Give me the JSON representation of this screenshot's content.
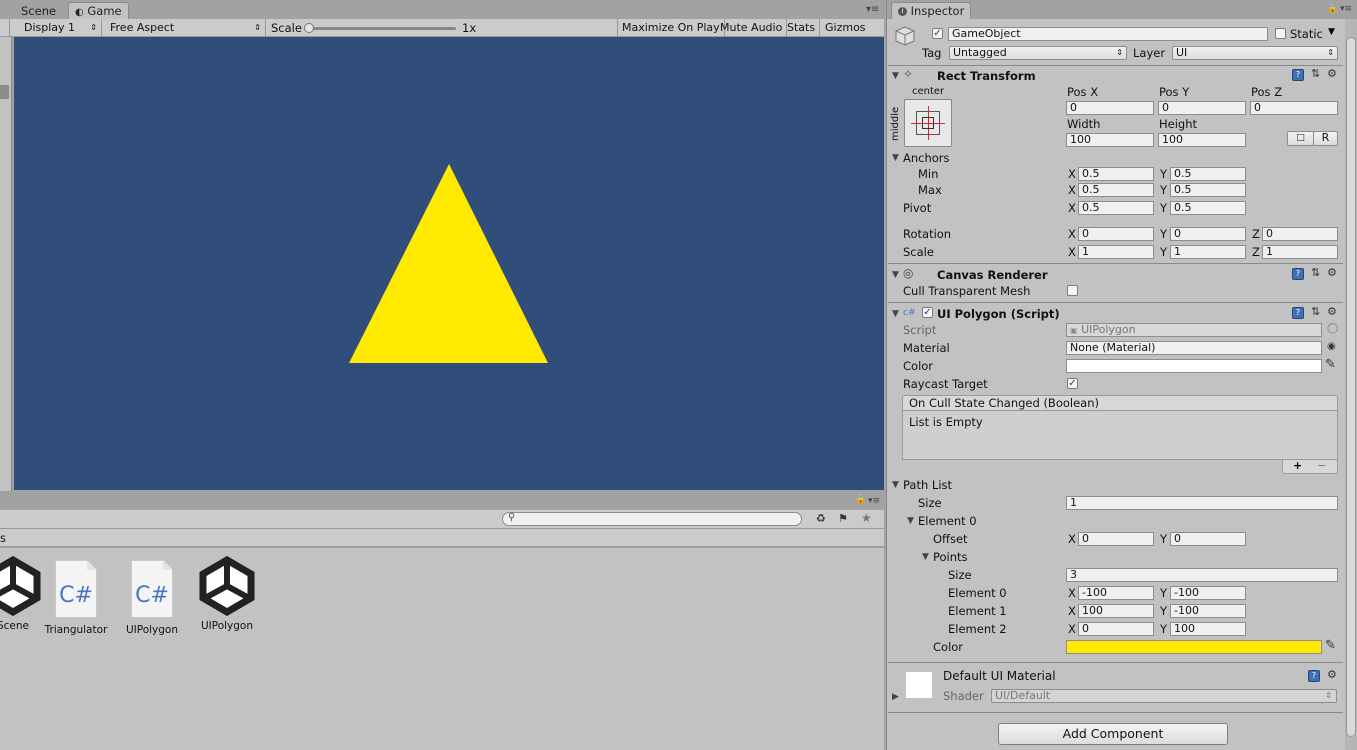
{
  "colors": {
    "game_bg": "#314d79",
    "triangle": "#ffea00",
    "yellow_field": "#ffea00",
    "editor_bg": "#c2c2c2",
    "inspector_bg": "#c2c2c2"
  },
  "tabs": {
    "scene": "Scene",
    "game": "Game",
    "inspector": "Inspector"
  },
  "game_toolbar": {
    "display": "Display 1",
    "aspect": "Free Aspect",
    "scale_label": "Scale",
    "scale_value": "1x",
    "maximize": "Maximize On Play",
    "mute": "Mute Audio",
    "stats": "Stats",
    "gizmos": "Gizmos"
  },
  "project": {
    "assets": [
      {
        "name": "Scene",
        "icon": "unity-scene-icon"
      },
      {
        "name": "Triangulator",
        "icon": "csharp-script-icon"
      },
      {
        "name": "UIPolygon",
        "icon": "csharp-script-icon"
      },
      {
        "name": "UIPolygon",
        "icon": "unity-scene-icon"
      }
    ],
    "cs_glyph": "C#",
    "partial_label": "s"
  },
  "inspector": {
    "object_name": "GameObject",
    "static_label": "Static",
    "tag_label": "Tag",
    "tag_value": "Untagged",
    "layer_label": "Layer",
    "layer_value": "UI",
    "rect_transform": {
      "title": "Rect Transform",
      "anchor_h": "center",
      "anchor_v": "middle",
      "pos_x_label": "Pos X",
      "pos_y_label": "Pos Y",
      "pos_z_label": "Pos Z",
      "pos_x": "0",
      "pos_y": "0",
      "pos_z": "0",
      "width_label": "Width",
      "height_label": "Height",
      "width": "100",
      "height": "100",
      "r_button": "R",
      "anchors_label": "Anchors",
      "min_label": "Min",
      "max_label": "Max",
      "min_x": "0.5",
      "min_y": "0.5",
      "max_x": "0.5",
      "max_y": "0.5",
      "pivot_label": "Pivot",
      "pivot_x": "0.5",
      "pivot_y": "0.5",
      "rotation_label": "Rotation",
      "rot_x": "0",
      "rot_y": "0",
      "rot_z": "0",
      "scale_label": "Scale",
      "scale_x": "1",
      "scale_y": "1",
      "scale_z": "1"
    },
    "canvas_renderer": {
      "title": "Canvas Renderer",
      "cull_label": "Cull Transparent Mesh"
    },
    "ui_polygon": {
      "title": "UI Polygon (Script)",
      "script_label": "Script",
      "script_value": "UIPolygon",
      "material_label": "Material",
      "material_value": "None (Material)",
      "color_label": "Color",
      "raycast_label": "Raycast Target",
      "event_title": "On Cull State Changed (Boolean)",
      "event_empty": "List is Empty",
      "plus": "+",
      "minus": "−",
      "path_list_label": "Path List",
      "size_label": "Size",
      "size_value": "1",
      "element0_label": "Element 0",
      "offset_label": "Offset",
      "offset_x": "0",
      "offset_y": "0",
      "points_label": "Points",
      "points_size_label": "Size",
      "points_size": "3",
      "points": [
        {
          "label": "Element 0",
          "x": "-100",
          "y": "-100"
        },
        {
          "label": "Element 1",
          "x": "100",
          "y": "-100"
        },
        {
          "label": "Element 2",
          "x": "0",
          "y": "100"
        }
      ],
      "element_color_label": "Color"
    },
    "material": {
      "title": "Default UI Material",
      "shader_label": "Shader",
      "shader_value": "UI/Default"
    },
    "add_component": "Add Component",
    "axis": {
      "x": "X",
      "y": "Y",
      "z": "Z"
    }
  }
}
